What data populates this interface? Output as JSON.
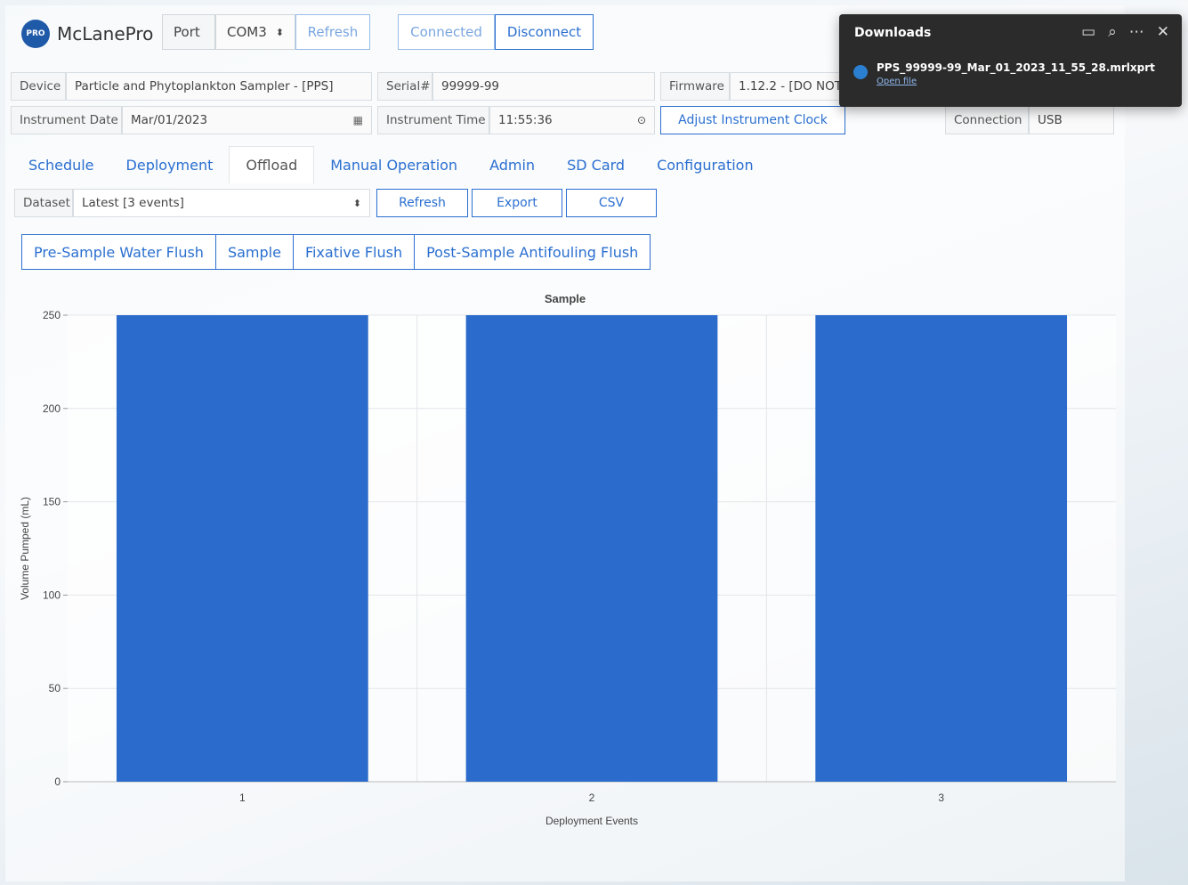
{
  "header": {
    "logo_badge": "PRO",
    "app_name": "McLanePro",
    "port_label": "Port",
    "port_value": "COM3",
    "refresh_label": "Refresh",
    "connected_label": "Connected",
    "disconnect_label": "Disconnect"
  },
  "device_info": {
    "device_label": "Device",
    "device_value": "Particle and Phytoplankton Sampler - [PPS]",
    "serial_label": "Serial#",
    "serial_value": "99999-99",
    "firmware_label": "Firmware",
    "firmware_value": "1.12.2 - [DO NOT",
    "date_label": "Instrument Date",
    "date_value": "Mar/01/2023",
    "time_label": "Instrument Time",
    "time_value": "11:55:36",
    "adjust_clock_label": "Adjust Instrument Clock",
    "connection_label": "Connection",
    "connection_value": "USB"
  },
  "tabs": [
    "Schedule",
    "Deployment",
    "Offload",
    "Manual Operation",
    "Admin",
    "SD Card",
    "Configuration"
  ],
  "active_tab": "Offload",
  "dataset": {
    "label": "Dataset",
    "value": "Latest [3 events]",
    "refresh_label": "Refresh",
    "export_label": "Export",
    "csv_label": "CSV"
  },
  "segments": [
    "Pre-Sample Water Flush",
    "Sample",
    "Fixative Flush",
    "Post-Sample Antifouling Flush"
  ],
  "downloads": {
    "title": "Downloads",
    "file_name": "PPS_99999-99_Mar_01_2023_11_55_28.mrlxprt",
    "open_file_label": "Open file"
  },
  "colors": {
    "accent": "#2a6fd0",
    "bar": "#2b6bcb",
    "panel_dark": "#2b2b2b"
  },
  "chart_data": {
    "type": "bar",
    "title": "Sample",
    "xlabel": "Deployment Events",
    "ylabel": "Volume Pumped (mL)",
    "categories": [
      "1",
      "2",
      "3"
    ],
    "values": [
      250,
      250,
      250
    ],
    "ylim": [
      0,
      250
    ],
    "yticks": [
      0,
      50,
      100,
      150,
      200,
      250
    ],
    "grid": true
  }
}
